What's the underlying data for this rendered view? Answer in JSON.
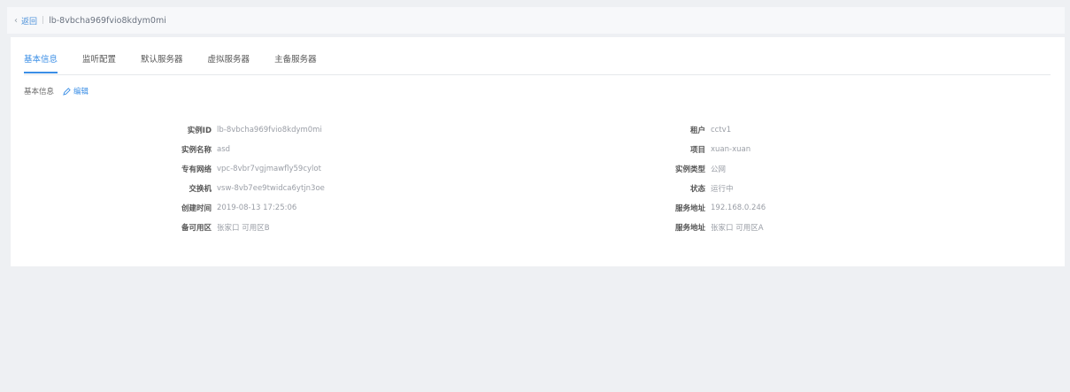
{
  "header": {
    "back_label": "返回",
    "instance_id": "lb-8vbcha969fvio8kdym0mi"
  },
  "tabs": [
    {
      "label": "基本信息",
      "active": true
    },
    {
      "label": "监听配置",
      "active": false
    },
    {
      "label": "默认服务器",
      "active": false
    },
    {
      "label": "虚拟服务器",
      "active": false
    },
    {
      "label": "主备服务器",
      "active": false
    }
  ],
  "section": {
    "title": "基本信息",
    "edit_label": "编辑"
  },
  "left_fields": [
    {
      "label": "实例ID",
      "value": "lb-8vbcha969fvio8kdym0mi"
    },
    {
      "label": "实例名称",
      "value": "asd"
    },
    {
      "label": "专有网络",
      "value": "vpc-8vbr7vgjmawfly59cylot"
    },
    {
      "label": "交换机",
      "value": "vsw-8vb7ee9twidca6ytjn3oe"
    },
    {
      "label": "创建时间",
      "value": "2019-08-13 17:25:06"
    },
    {
      "label": "备可用区",
      "value": "张家口 可用区B"
    }
  ],
  "right_fields": [
    {
      "label": "租户",
      "value": "cctv1"
    },
    {
      "label": "项目",
      "value": "xuan-xuan"
    },
    {
      "label": "实例类型",
      "value": "公网"
    },
    {
      "label": "状态",
      "value": "运行中"
    },
    {
      "label": "服务地址",
      "value": "192.168.0.246"
    },
    {
      "label": "服务地址",
      "value": "张家口 可用区A"
    }
  ],
  "colors": {
    "accent": "#3a8ee6",
    "page_bg": "#eef0f3",
    "panel_bg": "#ffffff"
  }
}
